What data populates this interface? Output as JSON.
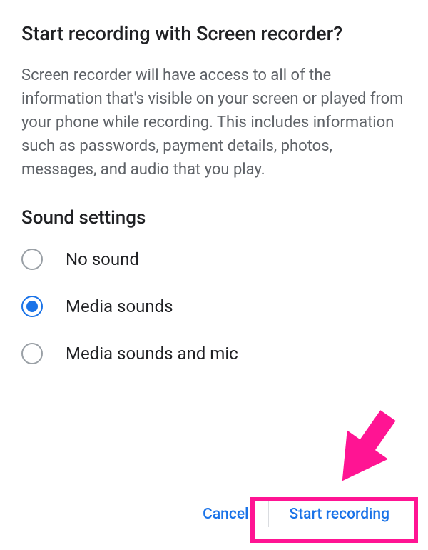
{
  "dialog": {
    "title": "Start recording with Screen recorder?",
    "description": "Screen recorder will have access to all of the information that's visible on your screen or played from your phone while recording. This includes information such as passwords, payment details, photos, messages, and audio that you play."
  },
  "soundSettings": {
    "heading": "Sound settings",
    "options": [
      {
        "label": "No sound",
        "selected": false
      },
      {
        "label": "Media sounds",
        "selected": true
      },
      {
        "label": "Media sounds and mic",
        "selected": false
      }
    ]
  },
  "buttons": {
    "cancel": "Cancel",
    "start": "Start recording"
  },
  "colors": {
    "accent": "#1a73e8",
    "annotation": "#ff1493"
  }
}
